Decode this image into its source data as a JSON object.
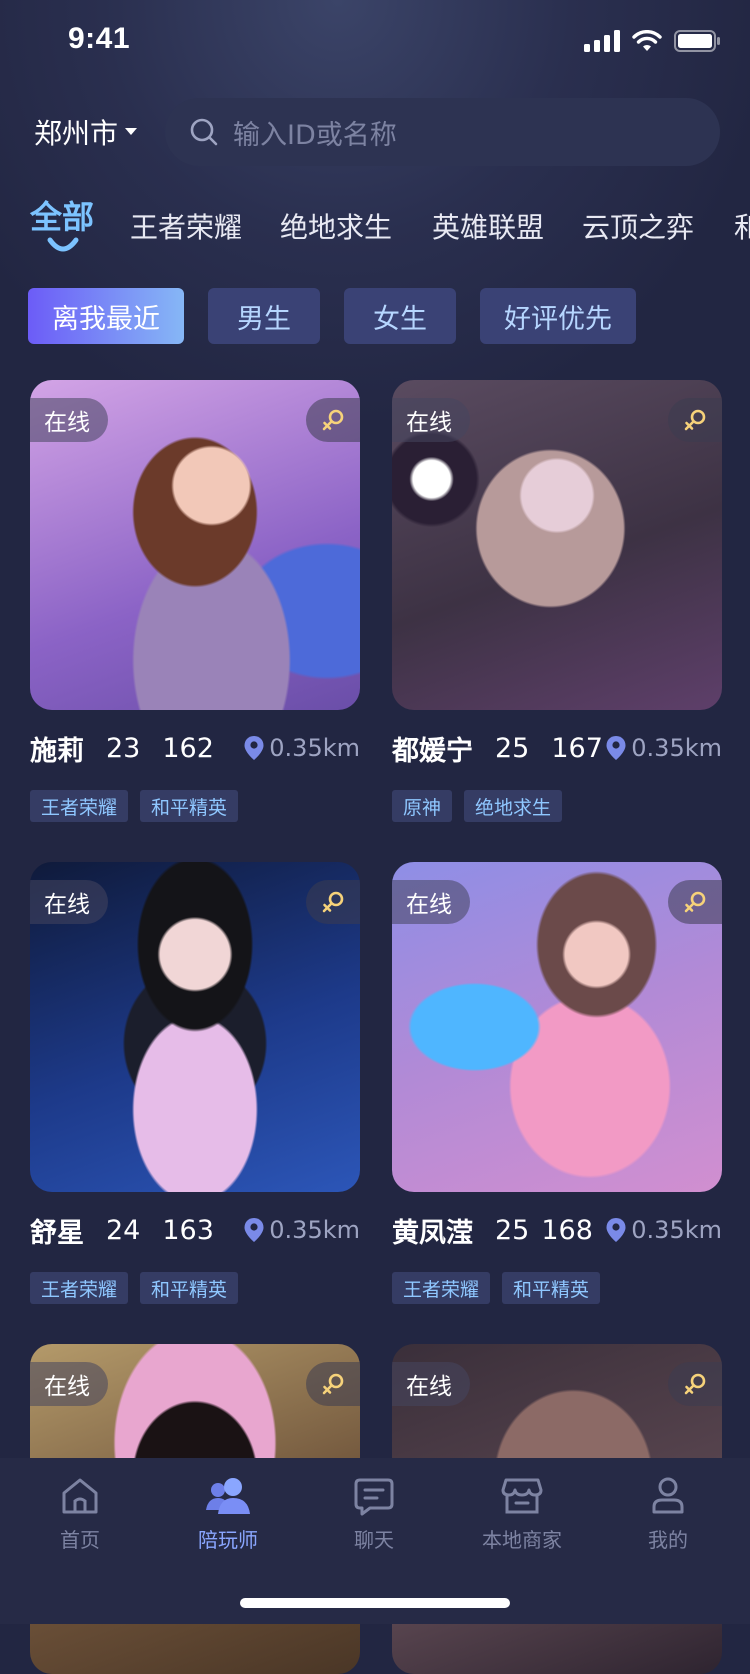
{
  "status": {
    "time": "9:41"
  },
  "header": {
    "city": "郑州市",
    "search_placeholder": "输入ID或名称"
  },
  "game_tabs": [
    "全部",
    "王者荣耀",
    "绝地求生",
    "英雄联盟",
    "云顶之弈",
    "和"
  ],
  "filters": [
    "离我最近",
    "男生",
    "女生",
    "好评优先"
  ],
  "cards": [
    {
      "online": "在线",
      "name": "施莉",
      "age": "23",
      "height": "162",
      "distance": "0.35km",
      "tags": [
        "王者荣耀",
        "和平精英"
      ]
    },
    {
      "online": "在线",
      "name": "都媛宁",
      "age": "25",
      "height": "167",
      "distance": "0.35km",
      "tags": [
        "原神",
        "绝地求生"
      ]
    },
    {
      "online": "在线",
      "name": "舒星",
      "age": "24",
      "height": "163",
      "distance": "0.35km",
      "tags": [
        "王者荣耀",
        "和平精英"
      ]
    },
    {
      "online": "在线",
      "name": "黄凤滢",
      "age": "25",
      "height": "168",
      "distance": "0.35km",
      "tags": [
        "王者荣耀",
        "和平精英"
      ]
    },
    {
      "online": "在线"
    },
    {
      "online": "在线"
    }
  ],
  "tabbar": [
    {
      "label": "首页",
      "icon": "home-icon"
    },
    {
      "label": "陪玩师",
      "icon": "companions-icon"
    },
    {
      "label": "聊天",
      "icon": "chat-icon"
    },
    {
      "label": "本地商家",
      "icon": "store-icon"
    },
    {
      "label": "我的",
      "icon": "profile-icon"
    }
  ],
  "colors": {
    "accent": "#7cc3ff",
    "background": "#222642",
    "tag_text": "#8fc7ff",
    "tabbar_active": "#8aa6ff"
  }
}
